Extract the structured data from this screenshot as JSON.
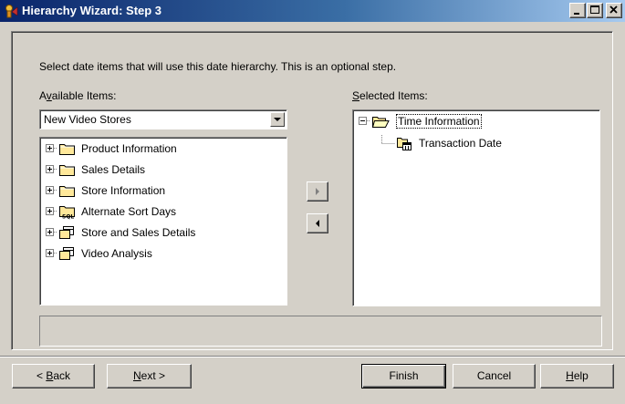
{
  "window": {
    "title": "Hierarchy Wizard: Step 3",
    "title_bar_color": "#0a246a"
  },
  "instruction": "Select date items that will use this date hierarchy. This is an optional step.",
  "available": {
    "label_prefix": "A",
    "label_accel": "v",
    "label_rest": "ailable Items:",
    "dropdown_value": "New Video Stores",
    "items": [
      {
        "label": "Product Information",
        "icon": "folder-icon"
      },
      {
        "label": "Sales Details",
        "icon": "folder-icon"
      },
      {
        "label": "Store Information",
        "icon": "folder-icon"
      },
      {
        "label": "Alternate Sort Days",
        "icon": "sql-folder-icon"
      },
      {
        "label": "Store and Sales Details",
        "icon": "table-folder-icon"
      },
      {
        "label": "Video Analysis",
        "icon": "table-folder-icon"
      }
    ]
  },
  "selected": {
    "label_accel": "S",
    "label_rest": "elected Items:",
    "root": {
      "label": "Time Information",
      "icon": "open-folder-icon"
    },
    "child": {
      "label": "Transaction Date",
      "icon": "date-attribute-icon"
    }
  },
  "buttons": {
    "back_prefix": "< ",
    "back_accel": "B",
    "back_rest": "ack",
    "next_accel": "N",
    "next_rest": "ext >",
    "finish": "Finish",
    "cancel": "Cancel",
    "help_accel": "H",
    "help_rest": "elp"
  }
}
